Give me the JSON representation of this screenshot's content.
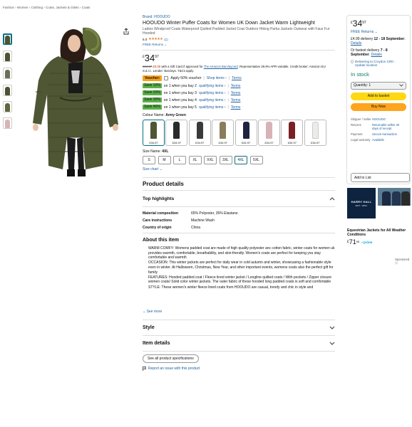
{
  "breadcrumb": [
    "Fashion",
    "Women",
    "Clothing",
    "Coats, Jackets & Gilets",
    "Coats"
  ],
  "breadcrumb_sep": "›",
  "product": {
    "brand": "Brand: HOOUDO",
    "title": "HOOUDO Winter Puffer Coats for Women UK Down Jacket Warm Lightweight",
    "subtitle": "Ladies Windproof Coats Waterproof Quilted Padded Jacket Coat Outdoor Hiking Parka Jackets Outwear with Faux Fur Hooded",
    "rating": "5.0",
    "stars": "★★★★★",
    "review_count": "(1)",
    "free_returns": "FREE Returns ⌄",
    "price_currency": "£",
    "price_whole": "34",
    "price_fraction": "97",
    "promo_strike": "£34.97",
    "promo_red": "£0.00",
    "promo_text": "with a Gift Card if approved for",
    "promo_link": "The Amazon Barclaycard",
    "promo_rest": ". Representative 28.9% APR variable. Credit broker: Amazon EU S.à.r.l.. Lender: Barclays. T&Cs apply."
  },
  "voucher": {
    "badge": "Voucher:",
    "text": "Apply 50% voucher",
    "shop_link": "Shop items ›",
    "terms": "Terms"
  },
  "savings": [
    {
      "badge": "Save 10%",
      "text": "on 1 when you buy 2",
      "link": "qualifying items ›",
      "terms": "Terms"
    },
    {
      "badge": "Save 20%",
      "text": "on 1 when you buy 3",
      "link": "qualifying items ›",
      "terms": "Terms"
    },
    {
      "badge": "Save 30%",
      "text": "on 1 when you buy 4",
      "link": "qualifying items ›",
      "terms": "Terms"
    },
    {
      "badge": "Save 40%",
      "text": "on 1 when you buy 5",
      "link": "qualifying items ›",
      "terms": "Terms"
    }
  ],
  "colour": {
    "label": "Colour Name:",
    "selected": "Army Green",
    "options": [
      {
        "price": "£34.97",
        "color": "#4f5634"
      },
      {
        "price": "£34.97",
        "color": "#2a2a2a"
      },
      {
        "price": "£34.97",
        "color": "#3a3a3a"
      },
      {
        "price": "£34.97",
        "color": "#8a7d5c"
      },
      {
        "price": "£34.97",
        "color": "#1f2340"
      },
      {
        "price": "£34.97",
        "color": "#d8b3b6"
      },
      {
        "price": "£34.97",
        "color": "#7a1f24"
      },
      {
        "price": "£34.97",
        "color": "#ecebe8"
      }
    ]
  },
  "size": {
    "label": "Size Name:",
    "selected": "4XL",
    "options": [
      "S",
      "M",
      "L",
      "XL",
      "XXL",
      "3XL",
      "4XL",
      "5XL"
    ],
    "chart_link": "Size chart ⌄"
  },
  "details": {
    "section_title": "Product details",
    "highlights_title": "Top highlights",
    "specs": [
      {
        "k": "Material composition",
        "v": "65% Polyester, 35% Elastane"
      },
      {
        "k": "Care instructions",
        "v": "Machine Wash"
      },
      {
        "k": "Country of origin",
        "v": "China"
      }
    ],
    "about_title": "About this item",
    "about": [
      "WARM COMFY: Womens padded coat are made of high quality polyester anc cotton fabric, winter coats for women uk provides warmth, comfortable, breathability, and skin-friendly. Women's coats are perfect for keeping you stay comfortable and warmth",
      "OCCASION: This winter jackets are perfect for daily wear in cold autumn and winter, showcasing a fashionable style even in winter. At Halloween, Christmas, New Year, and other important events, womens coats also the perfect gift for family",
      "FEATURES: Hooded padded coat / Fleece lined winter jacket / Longline quilted coats / With pockets / Zipper closure women coats/ Solid color winter jackets. The outer fabric of these hooded long padded coats is soft and comfortable",
      "STYLE: These women's winter fleece lined coats from HOOUDO are casual, trendy and chic in style and"
    ],
    "see_more": "⌄ See more",
    "style_title": "Style",
    "item_details_title": "Item details",
    "see_all_specs": "See all product specifications",
    "report_issue": "Report an issue with this product"
  },
  "buybox": {
    "price_currency": "£",
    "price_whole": "34",
    "price_fraction": "97",
    "free_returns": "FREE Returns ⌄",
    "delivery_price": "£4.99 delivery",
    "delivery_dates": "12 - 18 September",
    "details": "Details",
    "fastest": "Or fastest delivery",
    "fastest_dates": "7 - 8 September",
    "location": "Delivering to Croydon CR0 - Update location",
    "stock": "In stock",
    "quantity": "Quantity: 1",
    "add_to_basket": "Add to basket",
    "buy_now": "Buy Now",
    "info": [
      {
        "k": "Shipper / Seller",
        "v": "HOOUDO"
      },
      {
        "k": "Returns",
        "v": "Returnable within 30 days of receipt"
      },
      {
        "k": "Payment",
        "v": "Secure transaction"
      },
      {
        "k": "Legal warranty",
        "v": "Available"
      }
    ],
    "add_to_list": "Add to List"
  },
  "ad": {
    "brand_text": "HARRY HALL",
    "brand_sub": "EST. 1891",
    "title": "Equestrian Jackets for All Weather Conditions",
    "price_currency": "£",
    "price_whole": "71",
    "price_fraction": "95",
    "prime": "✓prime",
    "sponsored": "Sponsored ⓔ"
  },
  "colors": {
    "link": "#2162a1",
    "stock_green": "#067d62",
    "add_to_basket": "#ffd814",
    "buy_now": "#ffa41c",
    "voucher": "#f7a21b",
    "save_badge": "#5bb04a",
    "selected_border": "#007185",
    "coat": "#4f5634"
  },
  "icons": [
    "share-icon",
    "chevron-up-icon",
    "chevron-down-icon",
    "location-pin-icon",
    "flag-icon",
    "star-icon"
  ]
}
